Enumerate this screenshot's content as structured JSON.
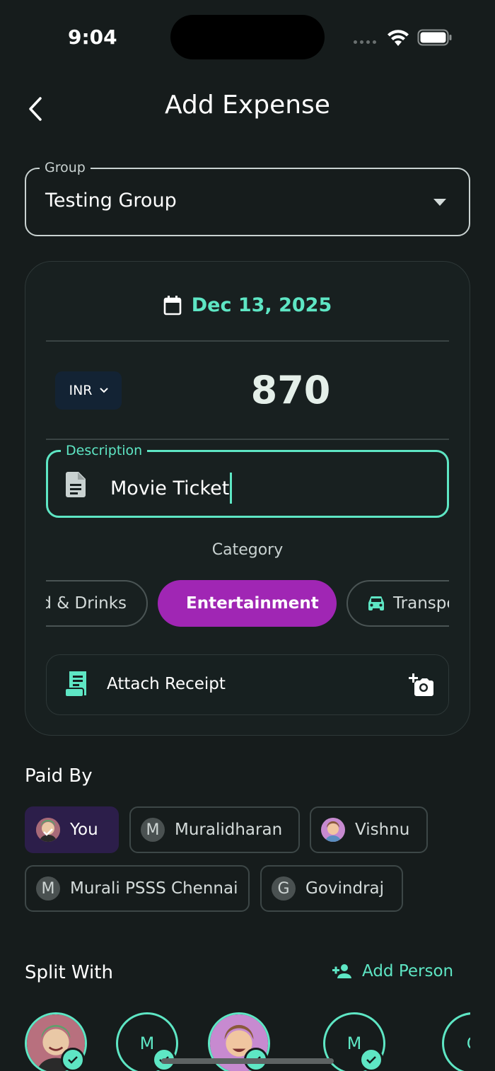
{
  "status_bar": {
    "time": "9:04"
  },
  "header": {
    "title": "Add Expense"
  },
  "group": {
    "label": "Group",
    "value": "Testing Group"
  },
  "expense": {
    "date": "Dec 13, 2025",
    "currency": "INR",
    "amount": "870",
    "description_label": "Description",
    "description_value": "Movie Ticket"
  },
  "category": {
    "label": "Category",
    "items": [
      {
        "label": "od & Drinks",
        "selected": false
      },
      {
        "label": "Entertainment",
        "selected": true
      },
      {
        "label": "Transpo",
        "selected": false
      }
    ]
  },
  "receipt": {
    "label": "Attach Receipt"
  },
  "paid_by": {
    "title": "Paid By",
    "people": [
      {
        "name": "You",
        "initial": "",
        "selected": true
      },
      {
        "name": "Muralidharan",
        "initial": "M",
        "selected": false
      },
      {
        "name": "Vishnu",
        "initial": "",
        "selected": false
      },
      {
        "name": "Murali PSSS Chennai",
        "initial": "M",
        "selected": false
      },
      {
        "name": "Govindraj",
        "initial": "G",
        "selected": false
      }
    ]
  },
  "split_with": {
    "title": "Split With",
    "add_label": "Add Person",
    "people": [
      {
        "initial": "",
        "checked": true
      },
      {
        "initial": "M",
        "checked": true
      },
      {
        "initial": "",
        "checked": true
      },
      {
        "initial": "M",
        "checked": true
      },
      {
        "initial": "G",
        "checked": false
      }
    ]
  },
  "colors": {
    "accent": "#5ee6c4",
    "selected_category": "#a026b4",
    "selected_payer": "#2c1e4a",
    "background": "#161c1c"
  }
}
